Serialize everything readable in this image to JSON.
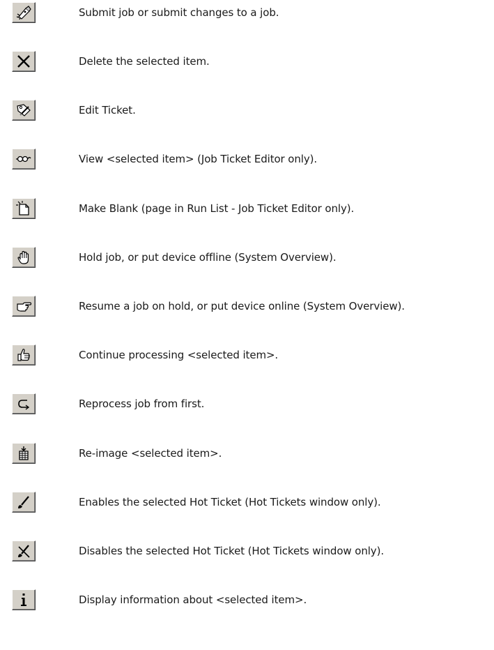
{
  "toolbar_legend": [
    {
      "icon": "submit-icon",
      "text": "Submit job or submit changes to a job."
    },
    {
      "icon": "delete-icon",
      "text": "Delete the selected item."
    },
    {
      "icon": "edit-ticket-icon",
      "text": "Edit Ticket."
    },
    {
      "icon": "view-icon",
      "text": "View <selected item> (Job Ticket Editor only)."
    },
    {
      "icon": "make-blank-icon",
      "text": "Make Blank (page in Run List - Job Ticket Editor only)."
    },
    {
      "icon": "hold-icon",
      "text": "Hold job, or put device offline (System Overview)."
    },
    {
      "icon": "resume-icon",
      "text": "Resume a job on hold, or put device online (System Overview)."
    },
    {
      "icon": "continue-icon",
      "text": "Continue processing <selected item>."
    },
    {
      "icon": "reprocess-icon",
      "text": "Reprocess job from first."
    },
    {
      "icon": "re-image-icon",
      "text": "Re-image <selected item>."
    },
    {
      "icon": "enable-hot-ticket-icon",
      "text": "Enables the selected Hot Ticket (Hot Tickets window only)."
    },
    {
      "icon": "disable-hot-ticket-icon",
      "text": "Disables the selected Hot Ticket (Hot Tickets window only)."
    },
    {
      "icon": "info-icon",
      "text": "Display information about <selected item>."
    }
  ]
}
